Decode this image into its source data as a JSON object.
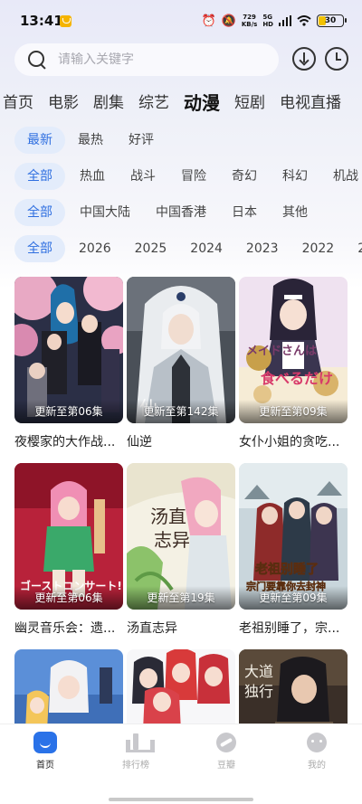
{
  "status_bar": {
    "time": "13:41",
    "speed_value": "729",
    "speed_unit": "KB/s",
    "network": "5G",
    "network_sub": "HD",
    "battery": "30",
    "battery_level": 0.3,
    "icons": [
      "alarm-icon",
      "mute-icon",
      "signal-icon",
      "wifi-icon",
      "battery-icon"
    ]
  },
  "search": {
    "placeholder": "请输入关键字"
  },
  "category_tabs": [
    "首页",
    "电影",
    "剧集",
    "综艺",
    "动漫",
    "短剧",
    "电视直播"
  ],
  "active_category": "动漫",
  "filters": {
    "sort": [
      "最新",
      "最热",
      "好评"
    ],
    "genre": [
      "全部",
      "热血",
      "战斗",
      "冒险",
      "奇幻",
      "科幻",
      "机战"
    ],
    "region": [
      "全部",
      "中国大陆",
      "中国香港",
      "日本",
      "其他"
    ],
    "year": [
      "全部",
      "2026",
      "2025",
      "2024",
      "2023",
      "2022",
      "2"
    ]
  },
  "cards": [
    {
      "title": "夜樱家的大作战...",
      "badge": "更新至第06集"
    },
    {
      "title": "仙逆",
      "badge": "更新至第142集"
    },
    {
      "title": "女仆小姐的贪吃...",
      "badge": "更新至第09集"
    },
    {
      "title": "幽灵音乐会：遗...",
      "badge": "更新至第06集"
    },
    {
      "title": "汤直志异",
      "badge": "更新至第19集"
    },
    {
      "title": "老祖别睡了，宗...",
      "badge": "更新至第09集"
    },
    {
      "title": "",
      "badge": ""
    },
    {
      "title": "",
      "badge": ""
    },
    {
      "title": "",
      "badge": ""
    }
  ],
  "bottom_nav": [
    {
      "label": "首页",
      "icon": "home-icon",
      "active": true
    },
    {
      "label": "排行榜",
      "icon": "rank-icon",
      "active": false
    },
    {
      "label": "豆瓣",
      "icon": "douban-icon",
      "active": false
    },
    {
      "label": "我的",
      "icon": "mine-icon",
      "active": false
    }
  ],
  "colors": {
    "accent": "#2f6fe0",
    "chip_selected_bg": "#e3ecfb",
    "nav_active": "#2a72e8"
  }
}
